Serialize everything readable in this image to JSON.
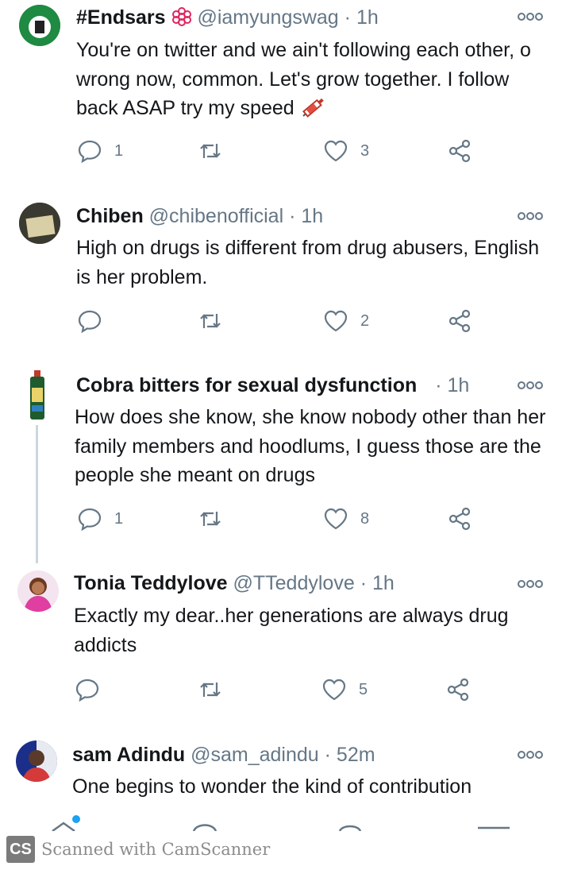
{
  "tweets": [
    {
      "name": "#Endsars",
      "handle": "@iamyungswag",
      "time": "· 1h",
      "text": "You're on twitter and we ain't following each other, o wrong now, common. Let's grow together. I follow back ASAP try my speed",
      "replies": "1",
      "likes": "3",
      "name_icon": "flower-icon",
      "text_icon": "syringe-icon"
    },
    {
      "name": "Chiben",
      "handle": "@chibenofficial",
      "time": "· 1h",
      "text": "High on drugs is different from drug abusers, English is her problem.",
      "replies": "",
      "likes": "2"
    },
    {
      "name": "Cobra bitters for sexual dysfunction",
      "handle": "",
      "time": "· 1h",
      "text": "How does she know,  she know nobody other than her family members and hoodlums, I guess those are the people she meant on drugs",
      "replies": "1",
      "likes": "8"
    },
    {
      "name": "Tonia Teddylove",
      "handle": "@TTeddylove",
      "time": "· 1h",
      "text": "Exactly my dear..her generations are always drug addicts",
      "replies": "",
      "likes": "5"
    },
    {
      "name": "sam Adindu",
      "handle": "@sam_adindu",
      "time": "· 52m",
      "text": "One begins to wonder the kind of contribution",
      "replies": "",
      "likes": ""
    }
  ],
  "watermark": {
    "logo": "CS",
    "text": "Scanned with CamScanner"
  },
  "colors": {
    "text": "#14171a",
    "muted": "#657786",
    "thread_line": "#ccd6dd",
    "unread_dot": "#1da1f2"
  }
}
